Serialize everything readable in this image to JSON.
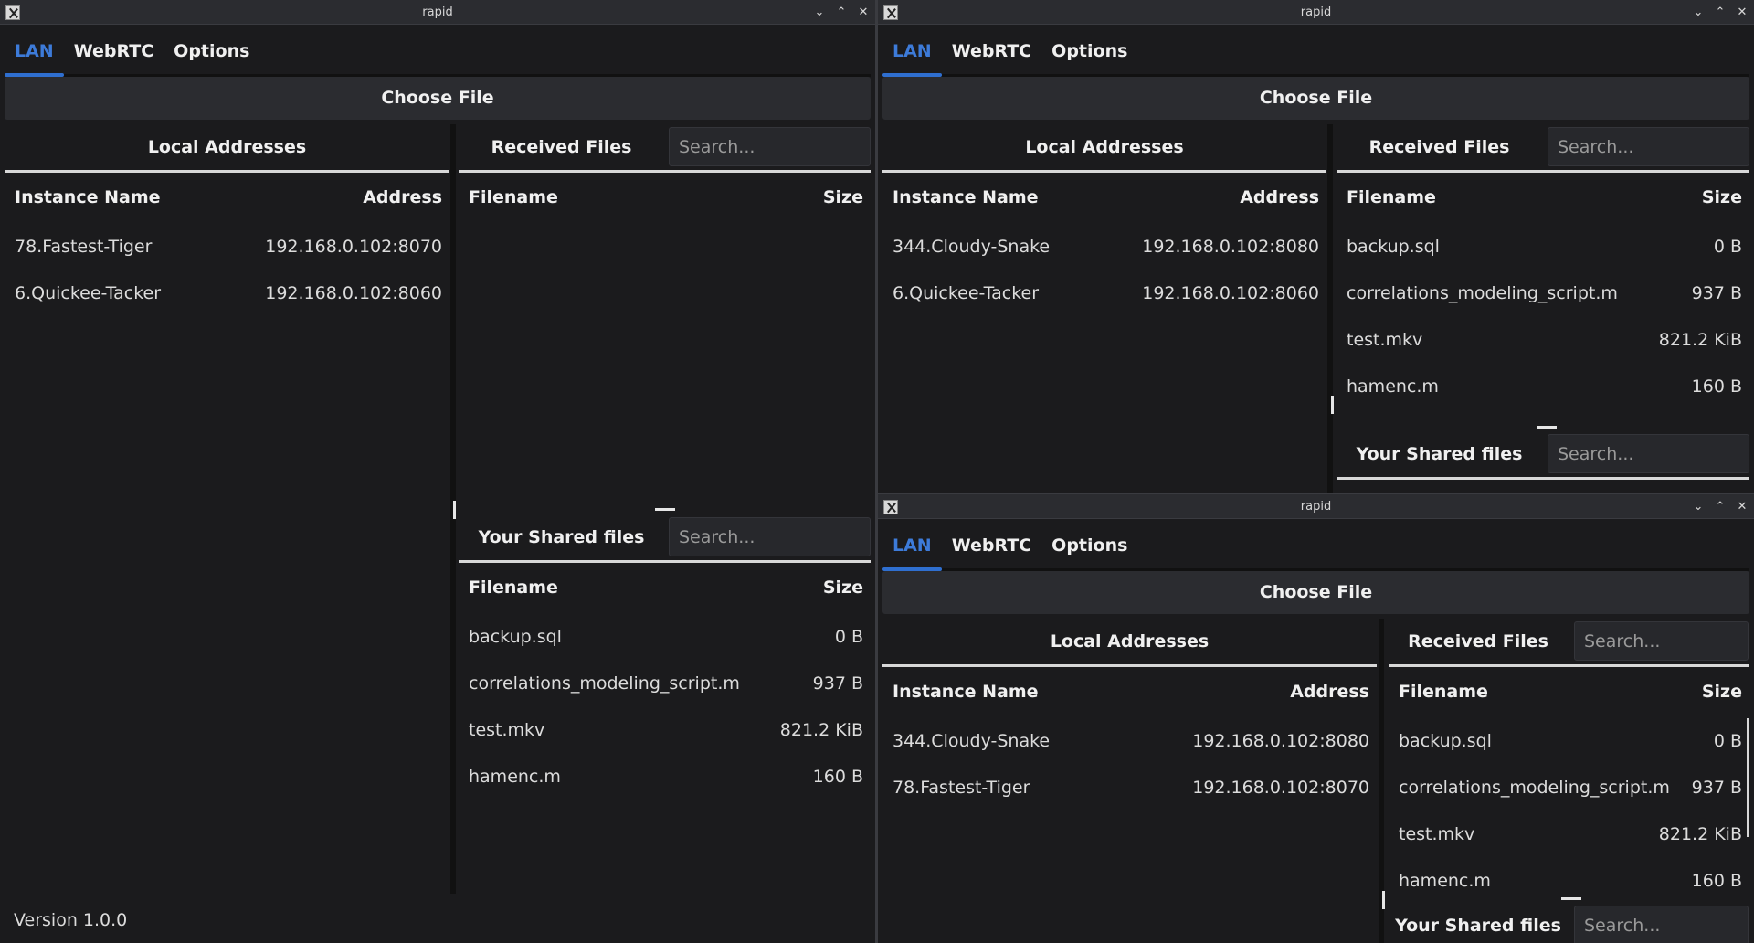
{
  "app": {
    "title": "rapid",
    "controls": [
      "⌄",
      "⌃",
      "✕"
    ]
  },
  "tabs": [
    "LAN",
    "WebRTC",
    "Options"
  ],
  "choose_file": "Choose File",
  "local_addresses": {
    "title": "Local Addresses",
    "col_name": "Instance Name",
    "col_address": "Address"
  },
  "received": {
    "title": "Received Files",
    "search_placeholder": "Search..."
  },
  "shared": {
    "title": "Your Shared files",
    "search_placeholder": "Search..."
  },
  "files_header": {
    "col_name": "Filename",
    "col_size": "Size"
  },
  "windows": [
    {
      "instances": [
        {
          "name": "78.Fastest-Tiger",
          "address": "192.168.0.102:8070"
        },
        {
          "name": "6.Quickee-Tacker",
          "address": "192.168.0.102:8060"
        }
      ],
      "received_files": [],
      "shared_files": [
        {
          "name": "backup.sql",
          "size": "0 B"
        },
        {
          "name": "correlations_modeling_script.m",
          "size": "937 B"
        },
        {
          "name": "test.mkv",
          "size": "821.2 KiB"
        },
        {
          "name": "hamenc.m",
          "size": "160 B"
        }
      ],
      "version": "Version 1.0.0"
    },
    {
      "instances": [
        {
          "name": "344.Cloudy-Snake",
          "address": "192.168.0.102:8080"
        },
        {
          "name": "6.Quickee-Tacker",
          "address": "192.168.0.102:8060"
        }
      ],
      "received_files": [
        {
          "name": "backup.sql",
          "size": "0 B"
        },
        {
          "name": "correlations_modeling_script.m",
          "size": "937 B"
        },
        {
          "name": "test.mkv",
          "size": "821.2 KiB"
        },
        {
          "name": "hamenc.m",
          "size": "160 B"
        }
      ]
    },
    {
      "instances": [
        {
          "name": "344.Cloudy-Snake",
          "address": "192.168.0.102:8080"
        },
        {
          "name": "78.Fastest-Tiger",
          "address": "192.168.0.102:8070"
        }
      ],
      "received_files": [
        {
          "name": "backup.sql",
          "size": "0 B"
        },
        {
          "name": "correlations_modeling_script.m",
          "size": "937 B"
        },
        {
          "name": "test.mkv",
          "size": "821.2 KiB"
        },
        {
          "name": "hamenc.m",
          "size": "160 B"
        }
      ]
    }
  ]
}
